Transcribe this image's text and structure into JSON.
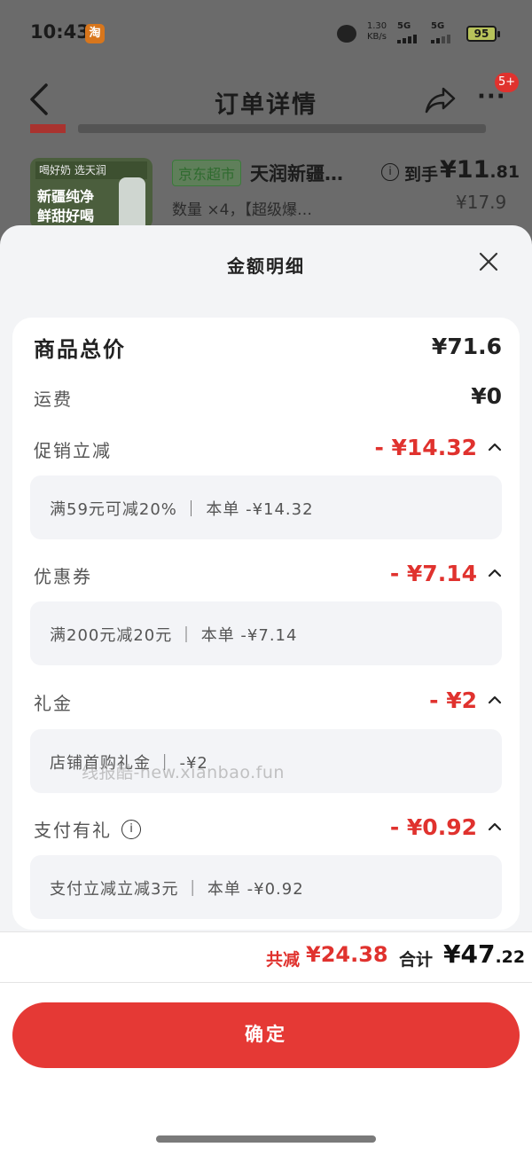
{
  "status_bar": {
    "time": "10:43",
    "app_badge": "淘",
    "net_speed_value": "1.30",
    "net_speed_unit": "KB/s",
    "sim1": "5G",
    "sim2": "5G",
    "battery": "95"
  },
  "nav": {
    "title": "订单详情",
    "more_glyph": "···",
    "badge": "5+"
  },
  "product": {
    "image_top": "天润",
    "image_line1": "新疆纯净",
    "image_line2": "鲜甜好喝",
    "image_slogan": "喝好奶 选天润",
    "store_tag": "京东超市",
    "name": "天润新疆…",
    "arrive_label": "到手",
    "arrive_price_main": "¥11",
    "arrive_price_dec": ".81",
    "quantity": "数量 ×4，【超级爆…",
    "original_price": "¥17.9",
    "info_glyph": "i"
  },
  "sheet": {
    "title": "金额明细",
    "rows": {
      "total_label": "商品总价",
      "total_value": "¥71.6",
      "shipping_label": "运费",
      "shipping_value": "¥0",
      "promo_label": "促销立减",
      "promo_value": "- ¥14.32",
      "promo_detail": "满59元可减20% ｜ 本单 -¥14.32",
      "coupon_label": "优惠券",
      "coupon_value": "- ¥7.14",
      "coupon_detail": "满200元减20元 ｜ 本单 -¥7.14",
      "gift_label": "礼金",
      "gift_value": "- ¥2",
      "gift_detail": "店铺首购礼金 ｜ -¥2",
      "pay_label": "支付有礼",
      "pay_value": "- ¥0.92",
      "pay_detail": "支付立减立减3元 ｜ 本单 -¥0.92",
      "pay_info_glyph": "i"
    },
    "watermark": "线报酷-new.xianbao.fun",
    "summary": {
      "reduce_label": "共减",
      "reduce_value": "¥24.38",
      "sum_label": "合计",
      "sum_main": "¥47",
      "sum_dec": ".22"
    },
    "confirm_label": "确定"
  },
  "colors": {
    "accent_red": "#e0322e",
    "button_red": "#e53935",
    "sheet_bg": "#f3f4f6"
  }
}
